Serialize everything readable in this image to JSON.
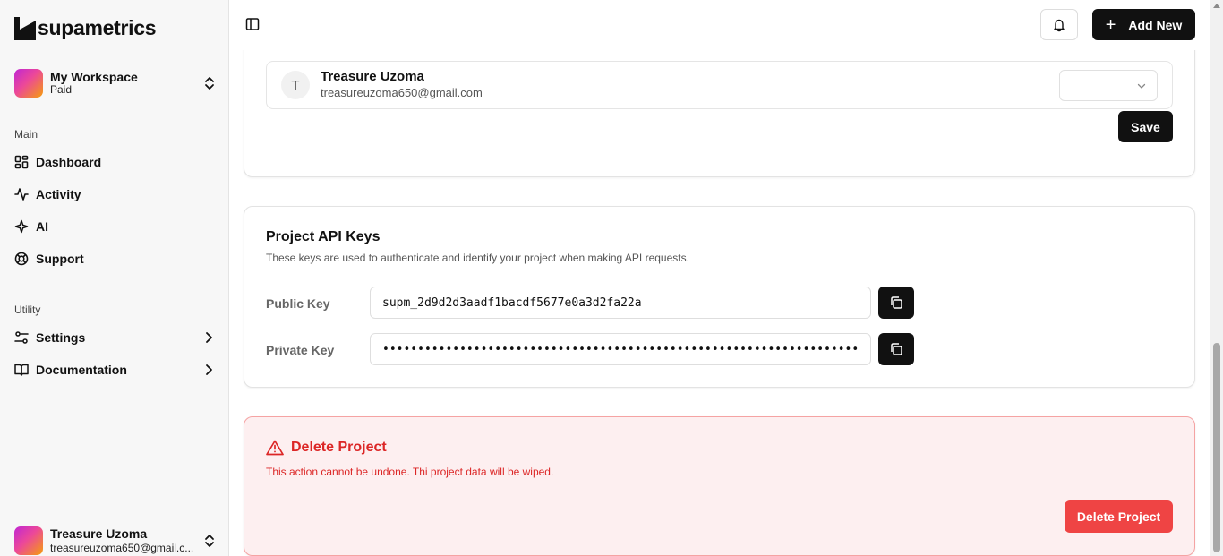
{
  "app": {
    "name": "supametrics"
  },
  "workspace": {
    "name": "My Workspace",
    "plan": "Paid"
  },
  "sidebar": {
    "main_label": "Main",
    "main_items": [
      {
        "label": "Dashboard",
        "icon": "dashboard-icon"
      },
      {
        "label": "Activity",
        "icon": "activity-icon"
      },
      {
        "label": "AI",
        "icon": "sparkle-icon"
      },
      {
        "label": "Support",
        "icon": "lifebuoy-icon"
      }
    ],
    "utility_label": "Utility",
    "utility_items": [
      {
        "label": "Settings",
        "icon": "settings-icon"
      },
      {
        "label": "Documentation",
        "icon": "book-icon"
      }
    ]
  },
  "user": {
    "name": "Treasure Uzoma",
    "email": "treasureuzoma650@gmail.c..."
  },
  "topbar": {
    "add_new_label": "Add New"
  },
  "members": {
    "member": {
      "initial": "T",
      "name": "Treasure Uzoma",
      "email": "treasureuzoma650@gmail.com",
      "role": ""
    },
    "save_label": "Save"
  },
  "api_keys": {
    "title": "Project API Keys",
    "description": "These keys are used to authenticate and identify your project when making API requests.",
    "public_label": "Public Key",
    "public_value": "supm_2d9d2d3aadf1bacdf5677e0a3d2fa22a",
    "private_label": "Private Key",
    "private_value": "••••••••••••••••••••••••••••••••••••••••••••••••••••••••••••••••••••"
  },
  "danger": {
    "title": "Delete Project",
    "description": "This action cannot be undone. Thi project data will be wiped.",
    "button_label": "Delete Project"
  },
  "colors": {
    "accent": "#111111",
    "danger": "#dc2626",
    "danger_button": "#ef4444",
    "danger_bg": "#fdeff0"
  }
}
